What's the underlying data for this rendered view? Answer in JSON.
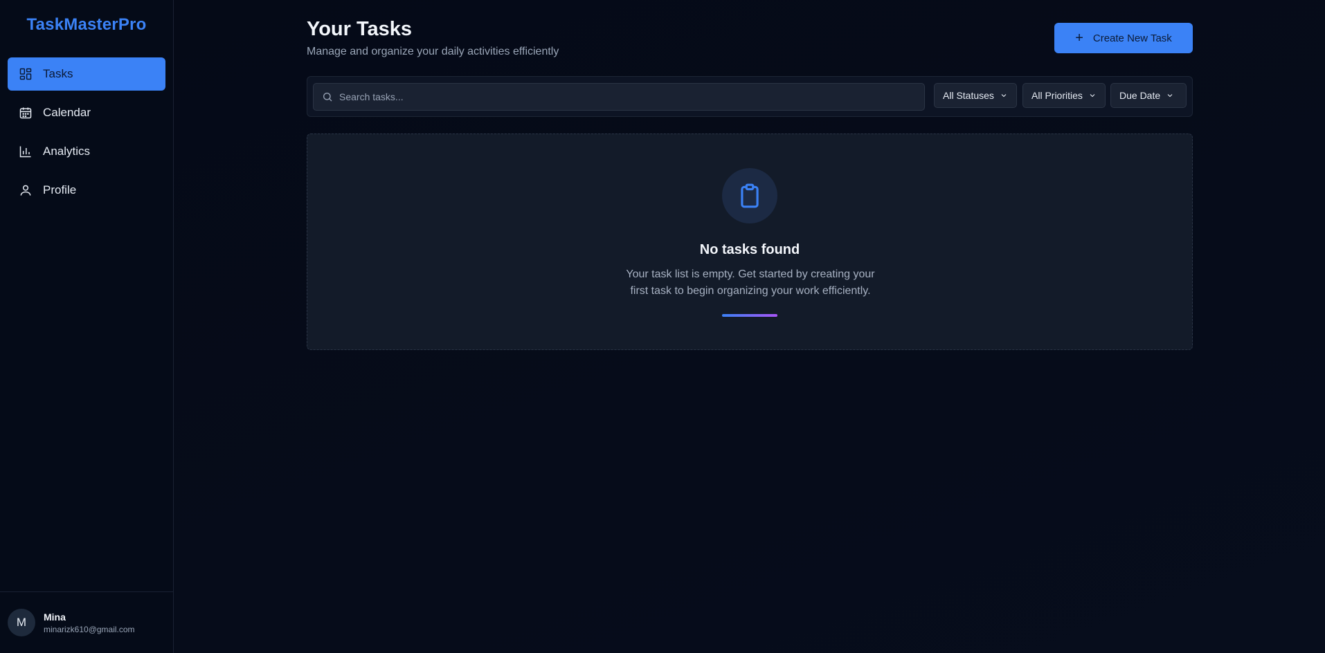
{
  "app": {
    "brand": "TaskMasterPro",
    "accent_color": "#3b82f6"
  },
  "sidebar": {
    "items": [
      {
        "label": "Tasks",
        "icon": "dashboard-icon",
        "active": true
      },
      {
        "label": "Calendar",
        "icon": "calendar-icon",
        "active": false
      },
      {
        "label": "Analytics",
        "icon": "bar-chart-icon",
        "active": false
      },
      {
        "label": "Profile",
        "icon": "user-icon",
        "active": false
      }
    ],
    "user": {
      "initial": "M",
      "name": "Mina",
      "email": "minarizk610@gmail.com"
    }
  },
  "header": {
    "title": "Your Tasks",
    "subtitle": "Manage and organize your daily activities efficiently",
    "create_button": "Create New Task"
  },
  "filters": {
    "search_placeholder": "Search tasks...",
    "status": "All Statuses",
    "priority": "All Priorities",
    "sort": "Due Date"
  },
  "empty_state": {
    "icon": "clipboard-icon",
    "title": "No tasks found",
    "line1": "Your task list is empty. Get started by creating your",
    "line2": "first task to begin organizing your work efficiently."
  }
}
